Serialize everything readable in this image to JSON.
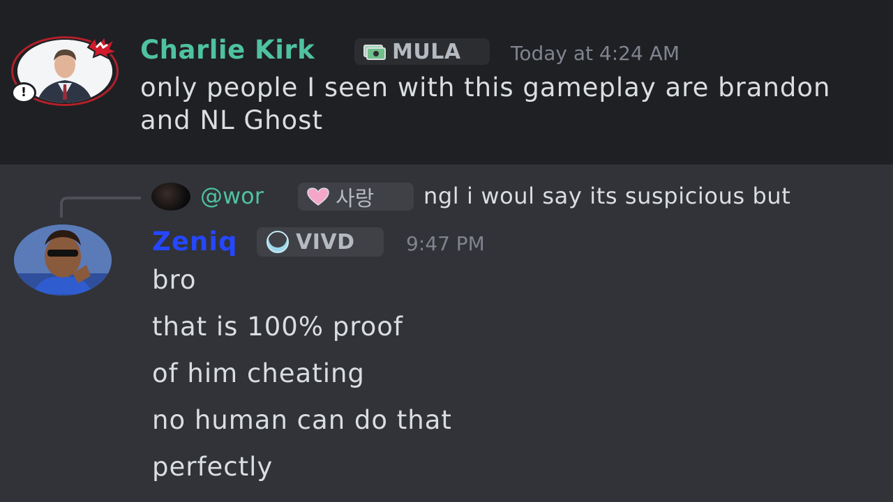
{
  "first_message": {
    "username": "Charlie Kirk",
    "user_color": "#4fc2a0",
    "guild_tag": "MULA",
    "guild_tag_icon": "money-icon",
    "timestamp": "Today at 4:24 AM",
    "content": "only people I seen with this gameplay are brandon and NL Ghost",
    "avatar_decorations": [
      "anger-icon",
      "alert-icon"
    ],
    "alert_symbol": "!"
  },
  "reply": {
    "mention": "@wor",
    "mention_color": "#4fc2a0",
    "guild_tag": "사랑",
    "guild_tag_icon": "heart-icon",
    "preview_text": "ngl i woul say its suspicious but"
  },
  "second_message": {
    "username": "Zeniq",
    "user_color": "#2447ff",
    "guild_tag": "VIVD",
    "guild_tag_icon": "moon-icon",
    "timestamp": "9:47 PM",
    "lines": [
      "bro",
      "that is 100% proof",
      "of him cheating",
      "no human can do that",
      "perfectly"
    ]
  }
}
